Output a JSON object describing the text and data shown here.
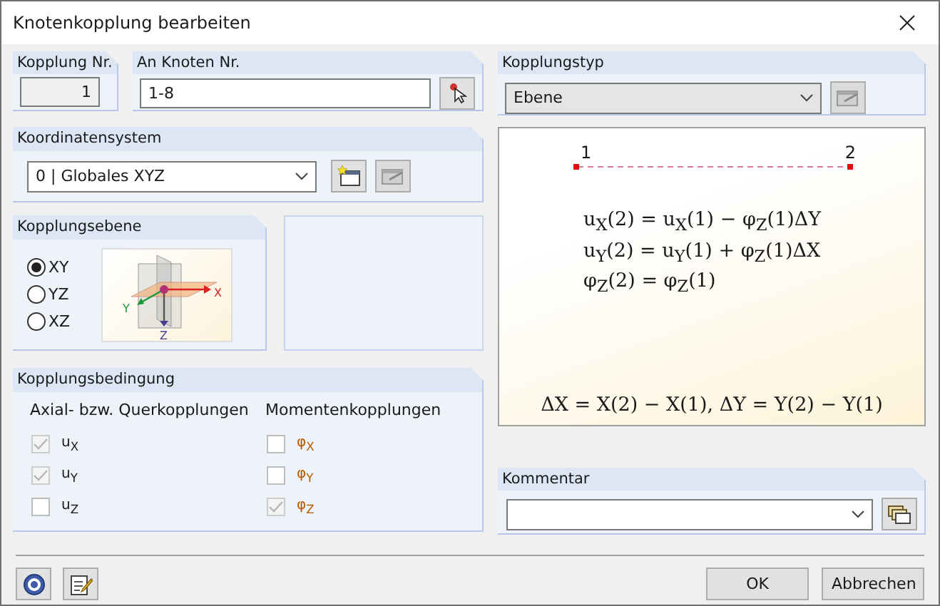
{
  "window": {
    "title": "Knotenkopplung bearbeiten"
  },
  "coupling_no": {
    "label": "Kopplung Nr.",
    "value": "1"
  },
  "nodes": {
    "label": "An Knoten Nr.",
    "value": "1-8"
  },
  "coordinate_system": {
    "label": "Koordinatensystem",
    "value": "0 | Globales XYZ"
  },
  "coupling_plane": {
    "label": "Kopplungsebene",
    "options": [
      {
        "label": "XY",
        "selected": true
      },
      {
        "label": "YZ",
        "selected": false
      },
      {
        "label": "XZ",
        "selected": false
      }
    ],
    "axes": [
      "X",
      "Y",
      "Z"
    ]
  },
  "conditions": {
    "label": "Kopplungsbedingung",
    "groups": [
      {
        "title": "Axial- bzw. Querkopplungen",
        "items": [
          {
            "label": "u$_{X}$",
            "checked": true,
            "disabled": true
          },
          {
            "label": "u$_{Y}$",
            "checked": true,
            "disabled": true
          },
          {
            "label": "u$_{Z}$",
            "checked": false,
            "disabled": false
          }
        ]
      },
      {
        "title": "Momentenkopplungen",
        "items": [
          {
            "label": "φ$_{X}$",
            "checked": false,
            "disabled": false
          },
          {
            "label": "φ$_{Y}$",
            "checked": false,
            "disabled": false
          },
          {
            "label": "φ$_{Z}$",
            "checked": true,
            "disabled": true
          }
        ]
      }
    ]
  },
  "coupling_type": {
    "label": "Kopplungstyp",
    "value": "Ebene"
  },
  "diagram": {
    "nodes": [
      "1",
      "2"
    ],
    "equations": [
      "u$_{X}$(2) = u$_{X}$(1) − φ$_{Z}$(1)ΔY",
      "u$_{Y}$(2) = u$_{Y}$(1) + φ$_{Z}$(1)ΔX",
      "φ$_{Z}$(2) = φ$_{Z}$(1)"
    ],
    "definition": "ΔX = X(2) − X(1), ΔY = Y(2) − Y(1)"
  },
  "comment": {
    "label": "Kommentar"
  },
  "buttons": [
    {
      "label": "OK"
    },
    {
      "label": "Abbrechen"
    }
  ]
}
